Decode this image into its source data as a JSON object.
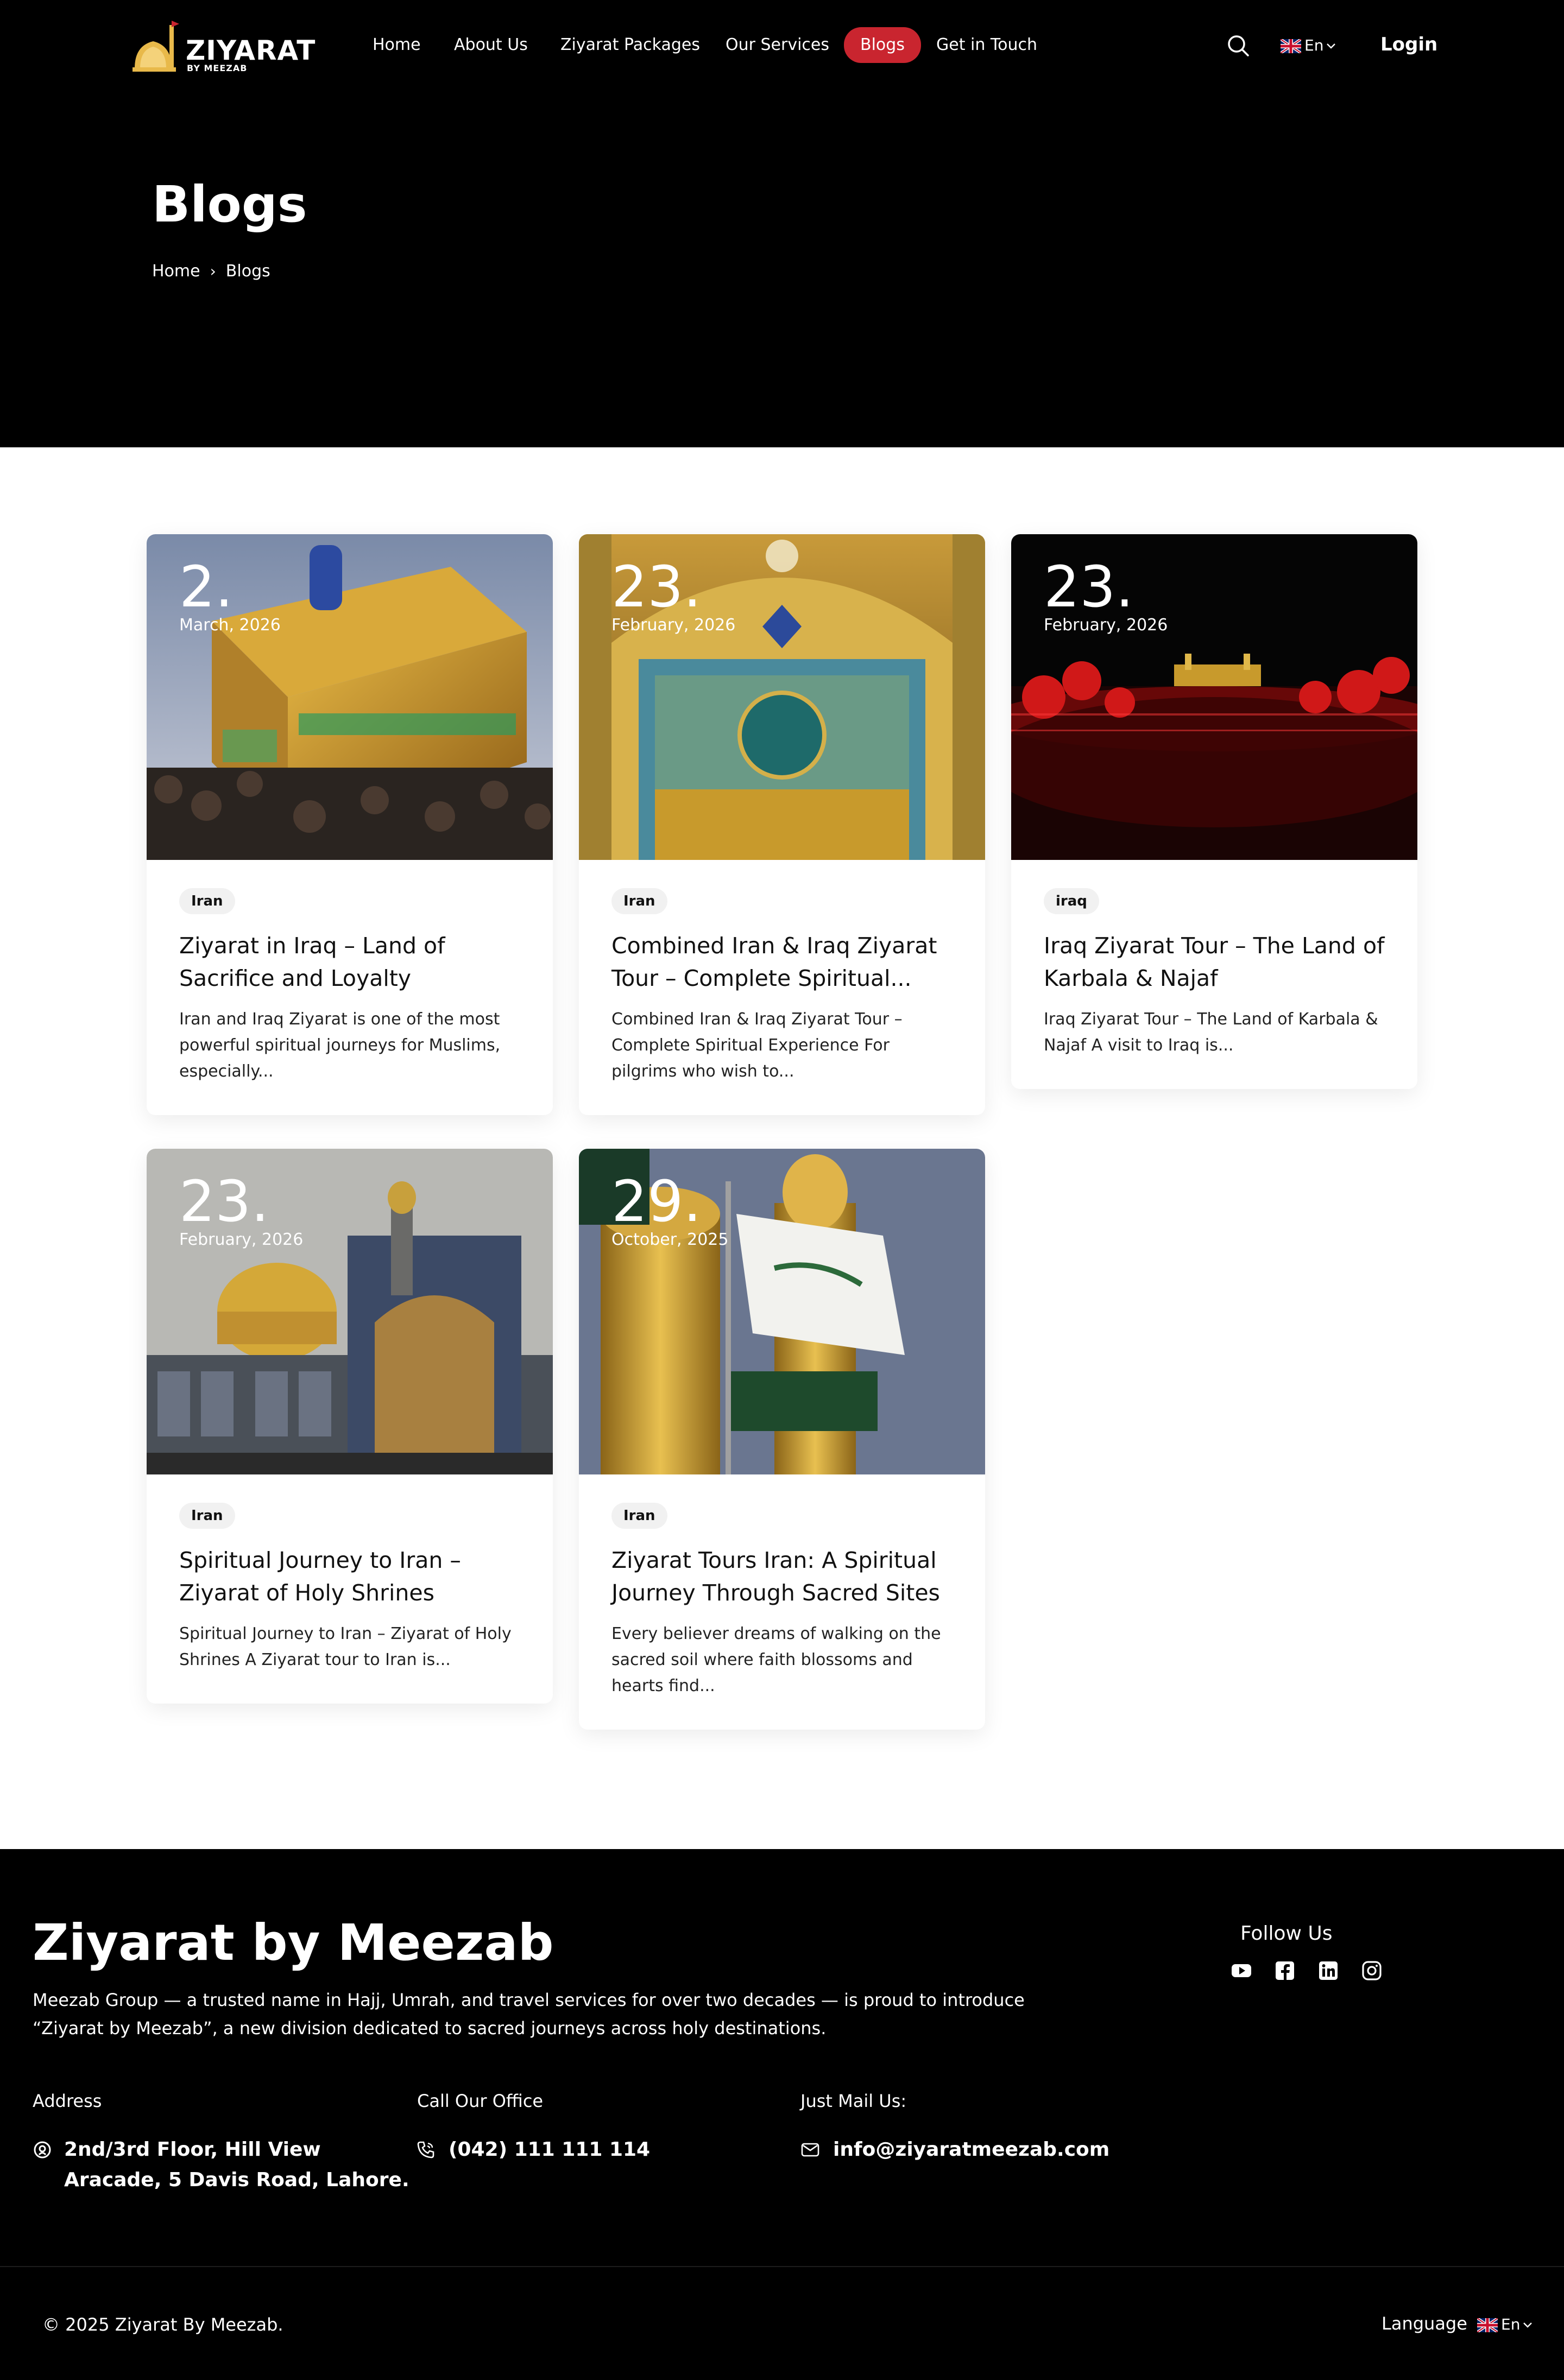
{
  "brand": {
    "logo_text": "ZIYARAT",
    "logo_sub": "BY MEEZAB"
  },
  "nav": {
    "items": [
      {
        "label": "Home"
      },
      {
        "label": "About Us"
      },
      {
        "label": "Ziyarat Packages"
      },
      {
        "label": "Our Services"
      },
      {
        "label": "Blogs",
        "active": true
      },
      {
        "label": "Get in Touch"
      }
    ],
    "language": "En",
    "login_label": "Login",
    "search_icon": "search-icon",
    "active_color": "#c9252f"
  },
  "hero": {
    "title": "Blogs",
    "breadcrumb": [
      "Home",
      "Blogs"
    ]
  },
  "posts": [
    {
      "day": "2.",
      "month": "March, 2026",
      "tag": "Iran",
      "title": "Ziyarat in Iraq – Land of Sacrifice and Loyalty",
      "excerpt": "Iran and Iraq Ziyarat is one of the most powerful spiritual journeys for Muslims, especially..."
    },
    {
      "day": "23.",
      "month": "February, 2026",
      "tag": "Iran",
      "title": "Combined Iran & Iraq Ziyarat Tour – Complete Spiritual...",
      "excerpt": "Combined Iran & Iraq Ziyarat Tour – Complete Spiritual Experience For pilgrims who wish to..."
    },
    {
      "day": "23.",
      "month": "February, 2026",
      "tag": "iraq",
      "title": "Iraq Ziyarat Tour – The Land of Karbala & Najaf",
      "excerpt": "Iraq Ziyarat Tour – The Land of Karbala & Najaf A visit to Iraq is..."
    },
    {
      "day": "23.",
      "month": "February, 2026",
      "tag": "Iran",
      "title": "Spiritual Journey to Iran – Ziyarat of Holy Shrines",
      "excerpt": "Spiritual Journey to Iran – Ziyarat of Holy Shrines A Ziyarat tour to Iran is..."
    },
    {
      "day": "29.",
      "month": "October, 2025",
      "tag": "Iran",
      "title": "Ziyarat Tours Iran: A Spiritual Journey Through Sacred Sites",
      "excerpt": "Every believer dreams of walking on the sacred soil where faith blossoms and hearts find..."
    }
  ],
  "footer": {
    "brand": "Ziyarat by Meezab",
    "description": "Meezab Group — a trusted name in Hajj, Umrah, and travel services for over two decades — is proud to introduce “Ziyarat by Meezab”, a new division dedicated to sacred journeys across holy destinations.",
    "follow_label": "Follow Us",
    "social_icons": [
      "youtube-icon",
      "facebook-icon",
      "linkedin-icon",
      "instagram-icon"
    ],
    "address_label": "Address",
    "address_line1": "2nd/3rd Floor, Hill View",
    "address_line2": "Aracade, 5 Davis Road, Lahore.",
    "phone_label": "Call Our Office",
    "phone": "(042) 111 111 114",
    "email_label": "Just Mail Us:",
    "email": "info@ziyaratmeezab.com",
    "copyright": "© 2025 Ziyarat By Meezab.",
    "language_label": "Language",
    "language": "En"
  }
}
